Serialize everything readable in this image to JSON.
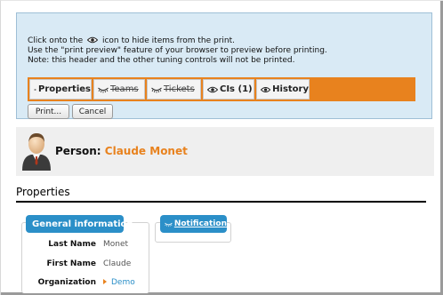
{
  "print_header": {
    "note_1_before": "Click onto the",
    "note_1_after": "icon to hide items from the print.",
    "note_2": "Use the \"print preview\" feature of your browser to preview before printing.",
    "note_3": "Note: this header and the other tuning controls will not be printed.",
    "tabs": [
      {
        "label": "Properties",
        "icon": "eye-icon",
        "struck": false
      },
      {
        "label": "Teams",
        "icon": "eye-closed-icon",
        "struck": true
      },
      {
        "label": "Tickets",
        "icon": "eye-closed-icon",
        "struck": true
      },
      {
        "label": "CIs (1)",
        "icon": "eye-icon",
        "struck": false
      },
      {
        "label": "History",
        "icon": "eye-icon",
        "struck": false
      }
    ],
    "print_button": "Print...",
    "cancel_button": "Cancel"
  },
  "person": {
    "class_label": "Person:",
    "name": "Claude Monet"
  },
  "properties": {
    "title": "Properties",
    "general_card": {
      "title": "General information",
      "fields": [
        {
          "label": "Last Name",
          "value": "Monet"
        },
        {
          "label": "First Name",
          "value": "Claude"
        },
        {
          "label": "Organization",
          "value": "Demo"
        }
      ]
    },
    "notification_card": {
      "title": "Notification"
    }
  },
  "colors": {
    "accent_orange": "#e8821e",
    "header_blue": "#d9eaf5",
    "card_title_blue": "#2b8fc8"
  }
}
